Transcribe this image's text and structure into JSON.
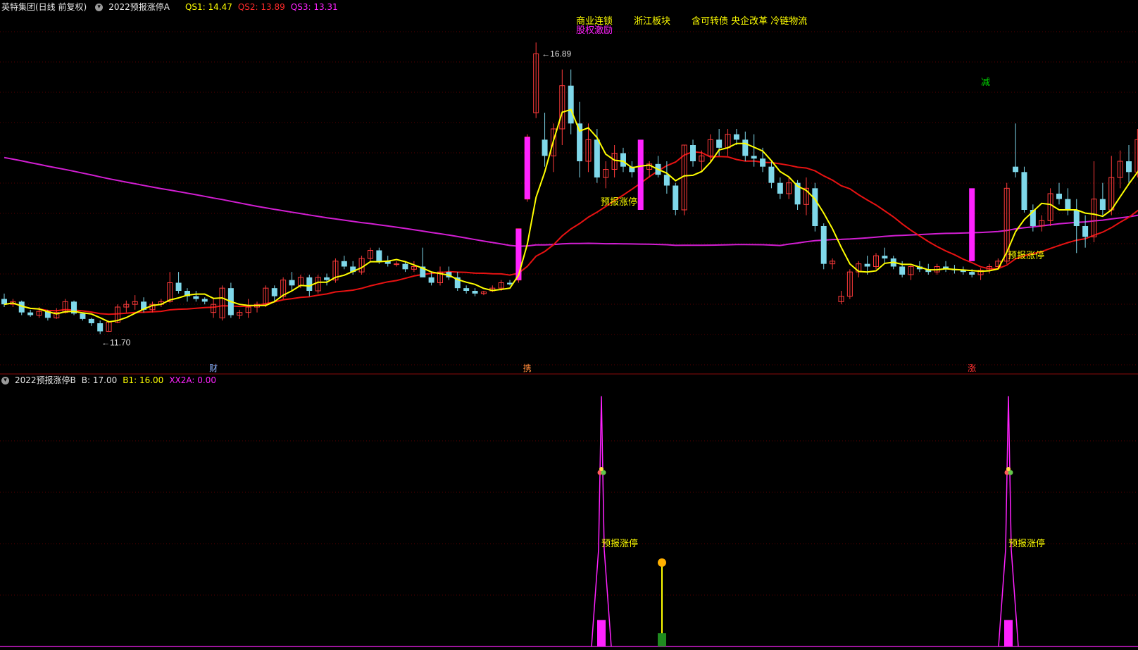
{
  "top_header": {
    "stock_title": "英特集团(日线 前复权)",
    "indicator_name": "2022预报涨停A",
    "qs1": "QS1: 14.47",
    "qs2": "QS2: 13.89",
    "qs3": "QS3: 13.31"
  },
  "bottom_header": {
    "indicator_name": "2022预报涨停B",
    "b": "B: 17.00",
    "b1": "B1: 16.00",
    "xx2a": "XX2A: 0.00"
  },
  "colors": {
    "background": "#000000",
    "up": "#ff3a3a",
    "down": "#7fd8ea",
    "ma_short": "#ffff00",
    "ma_mid": "#e81212",
    "ma_long": "#d21ed2",
    "signal_bar": "#ff22ff",
    "separator": "#8a0a0a",
    "dash_grid": "#5a0000"
  },
  "chart_data": [
    {
      "type": "candlestick",
      "ylim": [
        11.0,
        17.6
      ],
      "price_labels": {
        "high": "16.89",
        "low": "11.70"
      },
      "markers": [
        {
          "index": 24,
          "text": "财",
          "color": "#8db4ff"
        },
        {
          "index": 60,
          "text": "携",
          "color": "#ff8a3a"
        },
        {
          "index": 111,
          "text": "涨",
          "color": "#ff3030"
        }
      ],
      "overlay_texts": [
        {
          "text": "商业连锁",
          "color": "#ffff00"
        },
        {
          "text": "股权激励",
          "color": "#ff22ff"
        },
        {
          "text": "浙江板块",
          "color": "#ffff00"
        },
        {
          "text": "含可转债 央企改革 冷链物流",
          "color": "#ffff00"
        },
        {
          "text": "预报涨停",
          "color": "#ffff00"
        },
        {
          "text": "预报涨停",
          "color": "#ffff00"
        },
        {
          "text": "减",
          "color": "#00d400"
        }
      ],
      "ohlc": [
        [
          12.35,
          12.45,
          12.2,
          12.25
        ],
        [
          12.25,
          12.35,
          12.2,
          12.3
        ],
        [
          12.3,
          12.32,
          12.05,
          12.1
        ],
        [
          12.1,
          12.15,
          12.02,
          12.05
        ],
        [
          12.05,
          12.2,
          12.0,
          12.12
        ],
        [
          12.12,
          12.15,
          11.95,
          12.0
        ],
        [
          12.0,
          12.18,
          11.98,
          12.1
        ],
        [
          12.1,
          12.35,
          12.08,
          12.3
        ],
        [
          12.3,
          12.32,
          12.05,
          12.08
        ],
        [
          12.08,
          12.1,
          11.95,
          11.98
        ],
        [
          11.98,
          12.0,
          11.85,
          11.9
        ],
        [
          11.9,
          11.95,
          11.7,
          11.75
        ],
        [
          11.75,
          11.95,
          11.74,
          11.92
        ],
        [
          11.92,
          12.25,
          11.9,
          12.2
        ],
        [
          12.2,
          12.32,
          12.1,
          12.25
        ],
        [
          12.25,
          12.42,
          12.15,
          12.3
        ],
        [
          12.3,
          12.38,
          12.1,
          12.15
        ],
        [
          12.15,
          12.3,
          12.1,
          12.25
        ],
        [
          12.25,
          12.35,
          12.2,
          12.3
        ],
        [
          12.3,
          12.85,
          12.28,
          12.65
        ],
        [
          12.65,
          12.85,
          12.45,
          12.5
        ],
        [
          12.5,
          12.55,
          12.3,
          12.4
        ],
        [
          12.4,
          12.5,
          12.3,
          12.35
        ],
        [
          12.35,
          12.38,
          12.25,
          12.3
        ],
        [
          12.1,
          12.35,
          12.0,
          12.25
        ],
        [
          12.0,
          12.6,
          11.95,
          12.55
        ],
        [
          12.55,
          12.65,
          12.0,
          12.05
        ],
        [
          12.05,
          12.15,
          11.98,
          12.1
        ],
        [
          12.1,
          12.35,
          12.0,
          12.2
        ],
        [
          12.2,
          12.3,
          12.1,
          12.25
        ],
        [
          12.25,
          12.6,
          12.2,
          12.55
        ],
        [
          12.55,
          12.6,
          12.3,
          12.4
        ],
        [
          12.4,
          12.75,
          12.35,
          12.7
        ],
        [
          12.7,
          12.85,
          12.5,
          12.6
        ],
        [
          12.6,
          12.8,
          12.55,
          12.75
        ],
        [
          12.75,
          12.8,
          12.4,
          12.5
        ],
        [
          12.5,
          12.8,
          12.45,
          12.75
        ],
        [
          12.75,
          12.82,
          12.6,
          12.7
        ],
        [
          12.7,
          13.1,
          12.65,
          13.05
        ],
        [
          13.05,
          13.15,
          12.9,
          12.95
        ],
        [
          12.95,
          13.05,
          12.8,
          12.85
        ],
        [
          12.85,
          13.15,
          12.8,
          13.1
        ],
        [
          13.1,
          13.3,
          13.05,
          13.25
        ],
        [
          13.25,
          13.3,
          13.0,
          13.05
        ],
        [
          13.05,
          13.15,
          12.95,
          13.0
        ],
        [
          13.0,
          13.05,
          12.95,
          13.0
        ],
        [
          13.0,
          13.05,
          12.85,
          12.9
        ],
        [
          12.9,
          13.05,
          12.85,
          12.95
        ],
        [
          12.95,
          13.3,
          12.9,
          12.75
        ],
        [
          12.75,
          12.85,
          12.6,
          12.65
        ],
        [
          12.65,
          12.95,
          12.6,
          12.85
        ],
        [
          12.85,
          12.95,
          12.7,
          12.75
        ],
        [
          12.75,
          12.85,
          12.5,
          12.55
        ],
        [
          12.55,
          12.6,
          12.45,
          12.5
        ],
        [
          12.5,
          12.55,
          12.4,
          12.45
        ],
        [
          12.45,
          12.5,
          12.42,
          12.48
        ],
        [
          12.5,
          12.6,
          12.48,
          12.55
        ],
        [
          12.55,
          12.7,
          12.5,
          12.65
        ],
        [
          12.65,
          12.7,
          12.6,
          12.62
        ],
        [
          12.7,
          13.65,
          12.65,
          13.65
        ],
        [
          14.2,
          15.4,
          14.15,
          15.35
        ],
        [
          15.8,
          17.1,
          15.7,
          16.89
        ],
        [
          15.3,
          15.8,
          14.8,
          15.0
        ],
        [
          15.0,
          15.6,
          14.7,
          15.5
        ],
        [
          15.5,
          16.6,
          15.2,
          16.3
        ],
        [
          16.3,
          16.6,
          15.4,
          15.6
        ],
        [
          15.6,
          16.0,
          14.6,
          14.9
        ],
        [
          14.9,
          15.6,
          14.7,
          15.3
        ],
        [
          15.3,
          15.5,
          14.5,
          14.6
        ],
        [
          14.6,
          14.9,
          14.4,
          14.75
        ],
        [
          14.75,
          15.2,
          14.6,
          15.05
        ],
        [
          15.05,
          15.15,
          14.7,
          14.8
        ],
        [
          14.8,
          14.9,
          14.6,
          14.7
        ],
        [
          14.7,
          14.85,
          14.55,
          14.75
        ],
        [
          14.75,
          14.9,
          14.6,
          14.85
        ],
        [
          14.85,
          15.0,
          14.6,
          14.65
        ],
        [
          14.65,
          14.9,
          14.3,
          14.45
        ],
        [
          14.45,
          14.5,
          13.9,
          14.0
        ],
        [
          14.0,
          15.2,
          13.9,
          15.2
        ],
        [
          15.2,
          15.3,
          14.8,
          14.9
        ],
        [
          14.9,
          15.1,
          14.7,
          15.0
        ],
        [
          15.0,
          15.4,
          14.9,
          15.3
        ],
        [
          15.3,
          15.5,
          15.0,
          15.15
        ],
        [
          15.15,
          15.5,
          15.0,
          15.4
        ],
        [
          15.4,
          15.5,
          15.2,
          15.3
        ],
        [
          15.3,
          15.45,
          14.9,
          15.0
        ],
        [
          15.0,
          15.4,
          14.8,
          14.95
        ],
        [
          14.95,
          15.15,
          14.7,
          14.8
        ],
        [
          14.8,
          14.9,
          14.4,
          14.5
        ],
        [
          14.5,
          14.6,
          14.2,
          14.3
        ],
        [
          14.3,
          14.6,
          14.2,
          14.5
        ],
        [
          14.5,
          14.55,
          14.0,
          14.1
        ],
        [
          14.1,
          14.6,
          13.9,
          14.4
        ],
        [
          14.4,
          14.5,
          13.6,
          13.7
        ],
        [
          13.7,
          13.75,
          12.9,
          13.0
        ],
        [
          13.0,
          13.1,
          12.9,
          13.05
        ],
        [
          12.3,
          12.5,
          12.25,
          12.4
        ],
        [
          12.4,
          12.9,
          12.35,
          12.85
        ],
        [
          12.85,
          13.05,
          12.75,
          13.0
        ],
        [
          13.0,
          13.15,
          12.8,
          12.95
        ],
        [
          12.95,
          13.2,
          12.9,
          13.15
        ],
        [
          13.15,
          13.3,
          13.0,
          13.1
        ],
        [
          13.1,
          13.15,
          12.9,
          12.95
        ],
        [
          12.95,
          13.05,
          12.75,
          12.8
        ],
        [
          12.8,
          13.0,
          12.7,
          12.95
        ],
        [
          12.95,
          13.05,
          12.85,
          12.9
        ],
        [
          12.9,
          13.0,
          12.8,
          12.85
        ],
        [
          12.85,
          13.0,
          12.8,
          12.95
        ],
        [
          12.95,
          13.05,
          12.85,
          12.9
        ],
        [
          12.9,
          12.98,
          12.82,
          12.88
        ],
        [
          12.88,
          12.95,
          12.8,
          12.85
        ],
        [
          12.85,
          12.9,
          12.75,
          12.8
        ],
        [
          12.8,
          12.92,
          12.7,
          12.88
        ],
        [
          12.88,
          13.0,
          12.82,
          12.95
        ],
        [
          12.95,
          13.1,
          12.9,
          13.05
        ],
        [
          13.05,
          14.5,
          13.0,
          14.4
        ],
        [
          14.8,
          15.6,
          14.6,
          14.7
        ],
        [
          14.7,
          14.8,
          13.95,
          14.0
        ],
        [
          14.0,
          14.1,
          13.6,
          13.7
        ],
        [
          13.7,
          13.9,
          13.6,
          13.8
        ],
        [
          13.8,
          14.4,
          13.7,
          14.3
        ],
        [
          14.3,
          14.5,
          14.1,
          14.2
        ],
        [
          14.2,
          14.4,
          13.9,
          14.0
        ],
        [
          14.0,
          14.2,
          13.2,
          13.7
        ],
        [
          13.7,
          13.9,
          13.3,
          13.5
        ],
        [
          13.5,
          14.9,
          13.4,
          14.2
        ],
        [
          14.2,
          14.5,
          13.9,
          14.0
        ],
        [
          14.0,
          15.0,
          13.9,
          14.6
        ],
        [
          14.6,
          15.1,
          14.4,
          14.9
        ],
        [
          14.9,
          15.2,
          14.5,
          14.7
        ],
        [
          14.7,
          15.5,
          14.6,
          15.3
        ],
        [
          15.3,
          15.6,
          14.8,
          15.0
        ]
      ]
    },
    {
      "type": "signal",
      "signal_label": "预报涨停",
      "ylim": [
        0,
        17.5
      ],
      "spikes": [
        {
          "index": 68,
          "value": 17.0,
          "bar_value": 1.8
        },
        {
          "index": 116,
          "value": 17.0,
          "bar_value": 1.8
        }
      ],
      "yellow_stem": {
        "index": 74,
        "value": 5.6,
        "bar_value": 0.9
      }
    }
  ]
}
